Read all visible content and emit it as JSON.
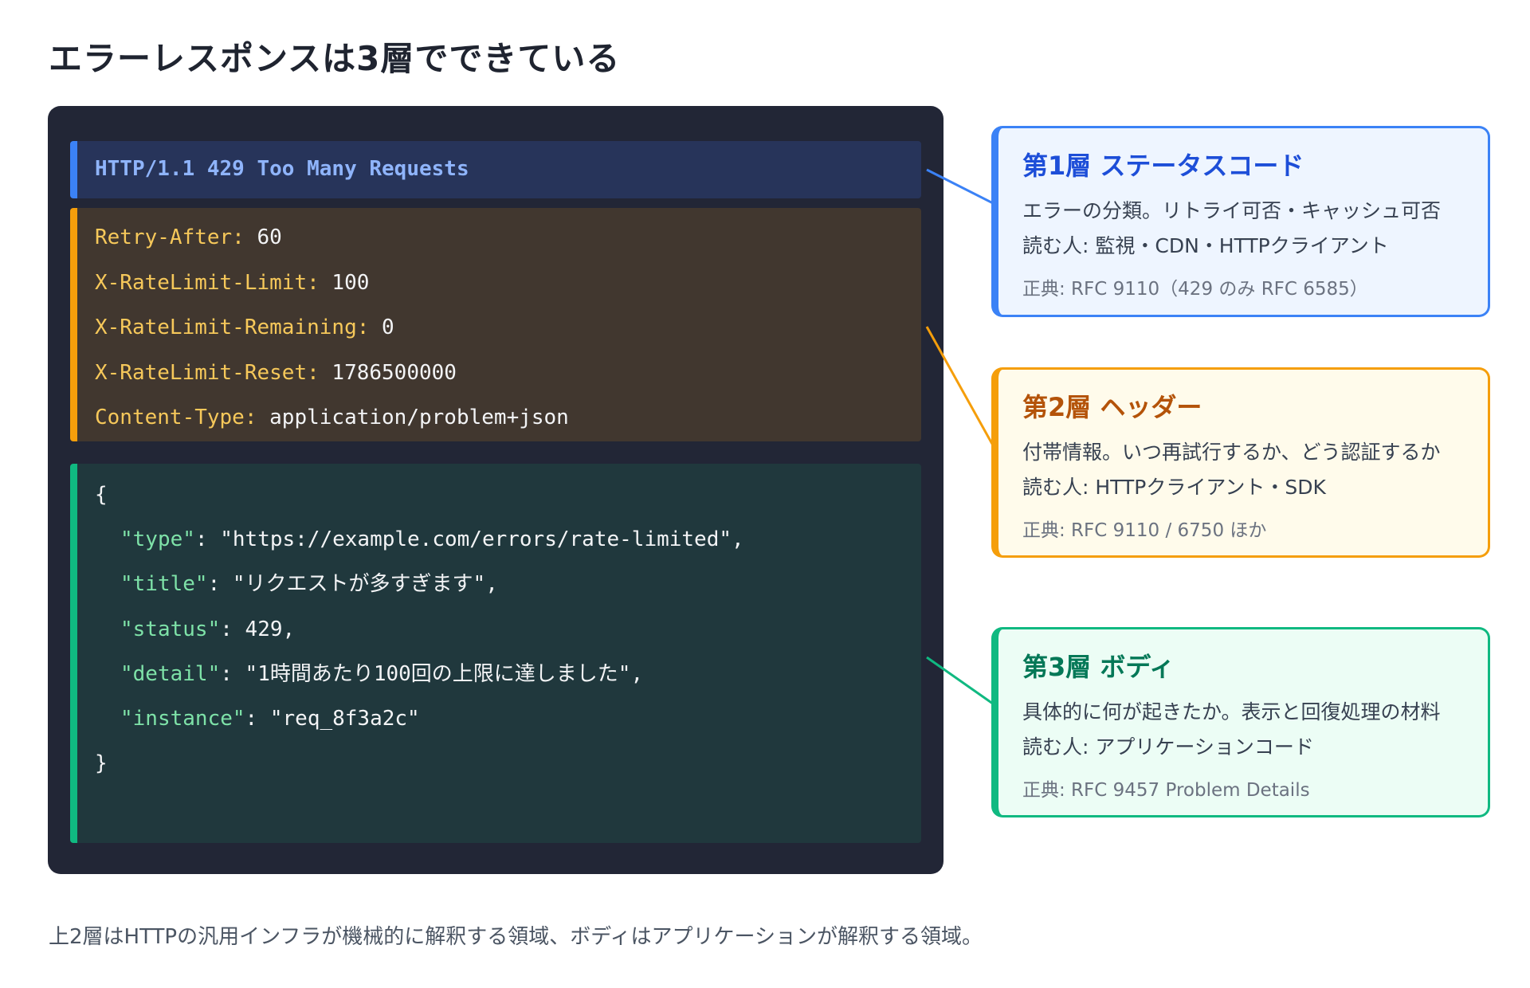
{
  "title": "エラーレスポンスは3層でできている",
  "code": {
    "status_line": "HTTP/1.1 429 Too Many Requests",
    "headers": [
      {
        "key": "Retry-After:",
        "value": " 60"
      },
      {
        "key": "X-RateLimit-Limit:",
        "value": " 100"
      },
      {
        "key": "X-RateLimit-Remaining:",
        "value": " 0"
      },
      {
        "key": "X-RateLimit-Reset:",
        "value": " 1786500000"
      },
      {
        "key": "Content-Type:",
        "value": " application/problem+json"
      }
    ],
    "body": {
      "open_brace": "{",
      "fields": [
        {
          "key": "\"type\"",
          "value": ": \"https://example.com/errors/rate-limited\","
        },
        {
          "key": "\"title\"",
          "value": ": \"リクエストが多すぎます\","
        },
        {
          "key": "\"status\"",
          "value": ": 429,"
        },
        {
          "key": "\"detail\"",
          "value": ": \"1時間あたり100回の上限に達しました\","
        },
        {
          "key": "\"instance\"",
          "value": ": \"req_8f3a2c\""
        }
      ],
      "close_brace": "}"
    }
  },
  "layers": [
    {
      "title": "第1層 ステータスコード",
      "description": "エラーの分類。リトライ可否・キャッシュ可否",
      "readers": "読む人: 監視・CDN・HTTPクライアント",
      "source": "正典: RFC 9110（429 のみ RFC 6585）"
    },
    {
      "title": "第2層 ヘッダー",
      "description": "付帯情報。いつ再試行するか、どう認証するか",
      "readers": "読む人: HTTPクライアント・SDK",
      "source": "正典: RFC 9110 / 6750 ほか"
    },
    {
      "title": "第3層 ボディ",
      "description": "具体的に何が起きたか。表示と回復処理の材料",
      "readers": "読む人: アプリケーションコード",
      "source": "正典: RFC 9457 Problem Details"
    }
  ],
  "colors": {
    "layer1": "#3b82f6",
    "layer2": "#f59e0b",
    "layer3": "#10b981",
    "panel_bg": "#222636"
  },
  "footnote": "上2層はHTTPの汎用インフラが機械的に解釈する領域、ボディはアプリケーションが解釈する領域。"
}
